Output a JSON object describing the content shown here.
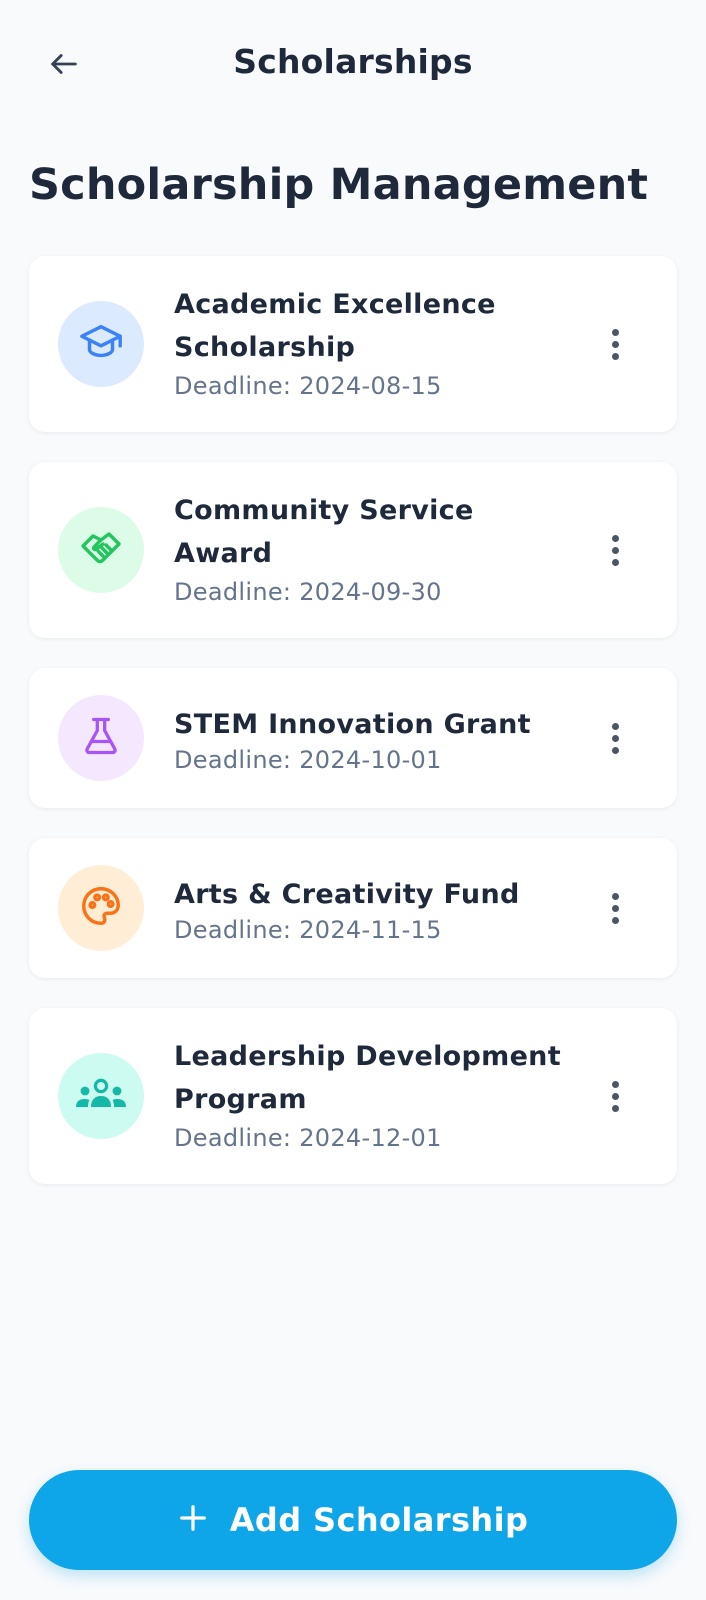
{
  "header": {
    "title": "Scholarships"
  },
  "page": {
    "title": "Scholarship Management"
  },
  "scholarships": [
    {
      "name": "Academic Excellence Scholarship",
      "deadline": "Deadline: 2024-08-15",
      "icon": "graduation-cap-icon",
      "color": "#3b82f6",
      "bg": "#dbeafe"
    },
    {
      "name": "Community Service Award",
      "deadline": "Deadline: 2024-09-30",
      "icon": "handshake-icon",
      "color": "#22c55e",
      "bg": "#dcfce7"
    },
    {
      "name": "STEM Innovation Grant",
      "deadline": "Deadline: 2024-10-01",
      "icon": "flask-icon",
      "color": "#a855f7",
      "bg": "#f3e8ff"
    },
    {
      "name": "Arts & Creativity Fund",
      "deadline": "Deadline: 2024-11-15",
      "icon": "palette-icon",
      "color": "#f97316",
      "bg": "#ffedd5"
    },
    {
      "name": "Leadership Development Program",
      "deadline": "Deadline: 2024-12-01",
      "icon": "people-group-icon",
      "color": "#14b8a6",
      "bg": "#ccfbf1"
    }
  ],
  "add_button": {
    "label": "Add Scholarship"
  },
  "colors": {
    "accent": "#0ea5e9",
    "background": "#f8fafc",
    "text": "#1e293b",
    "muted": "#64748b"
  }
}
